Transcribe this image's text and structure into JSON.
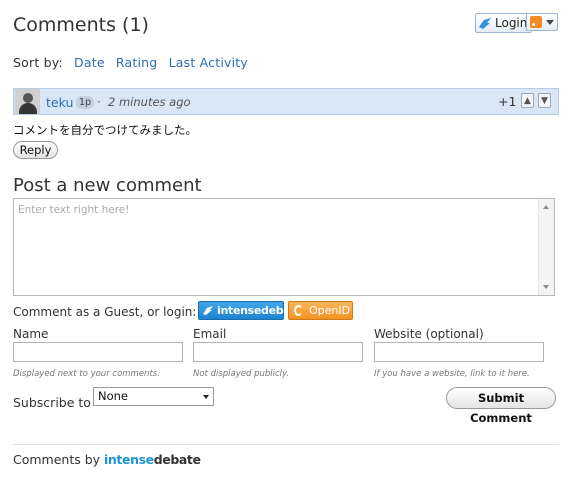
{
  "header": {
    "title": "Comments (1)",
    "login_label": "Login",
    "sort_label": "Sort by:",
    "sort_options": [
      "Date",
      "Rating",
      "Last Activity"
    ]
  },
  "comment": {
    "author": "teku",
    "reputation": "1p",
    "separator": "·",
    "time": "2 minutes ago",
    "score": "+1",
    "text": "コメントを自分でつけてみました。",
    "reply_label": "Reply"
  },
  "post": {
    "title": "Post a new comment",
    "placeholder": "Enter text right here!",
    "guest_label": "Comment as a Guest, or login:",
    "intensedebate_label": "intensedebate",
    "openid_label": "OpenID",
    "fields": [
      {
        "label": "Name",
        "hint": "Displayed next to your comments."
      },
      {
        "label": "Email",
        "hint": "Not displayed publicly."
      },
      {
        "label": "Website (optional)",
        "hint": "If you have a website, link to it here."
      }
    ],
    "subscribe_label": "Subscribe to",
    "subscribe_value": "None",
    "submit_label": "Submit Comment"
  },
  "footer": {
    "prefix": "Comments by",
    "brand_part1": "intense",
    "brand_part2": "debate"
  },
  "colors": {
    "link": "#2a6fb0",
    "comment_header_bg": "#d9e6f6",
    "intensedebate_blue": "#1e83cf",
    "openid_orange": "#f39321"
  }
}
